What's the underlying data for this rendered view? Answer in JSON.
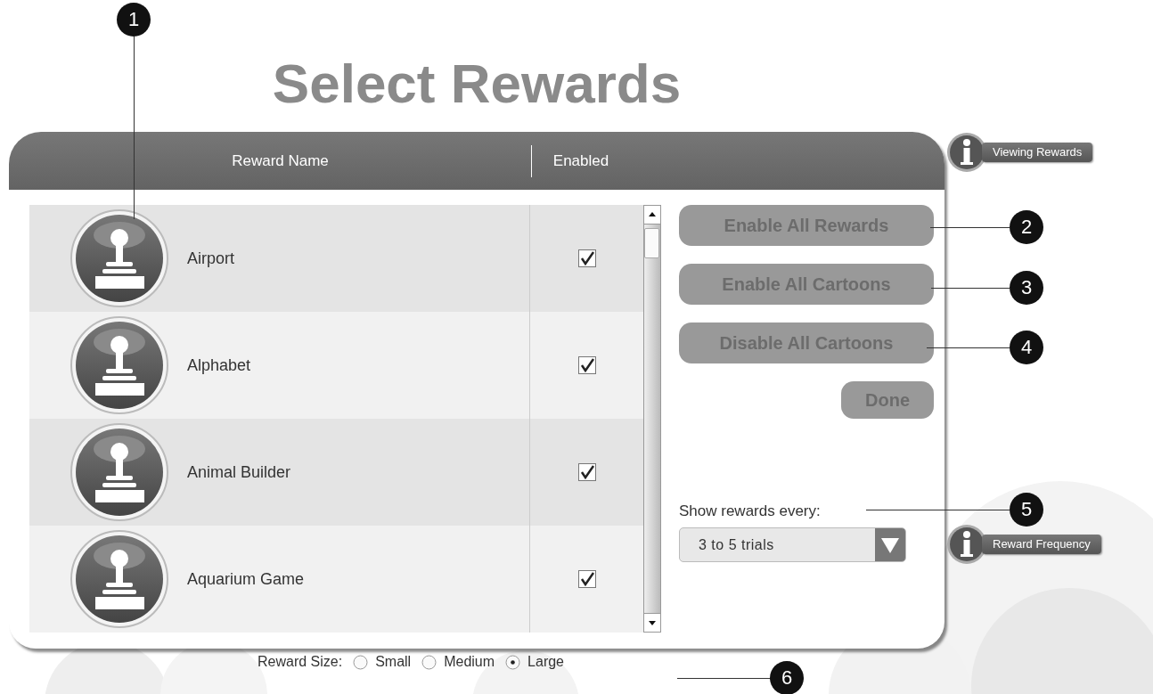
{
  "title": "Select Rewards",
  "table": {
    "columns": [
      "Reward Name",
      "Enabled"
    ],
    "rows": [
      {
        "name": "Airport",
        "enabled": true
      },
      {
        "name": "Alphabet",
        "enabled": true
      },
      {
        "name": "Animal Builder",
        "enabled": true
      },
      {
        "name": "Aquarium Game",
        "enabled": true
      }
    ]
  },
  "actions": [
    "Enable All Rewards",
    "Enable All Cartoons",
    "Disable All Cartoons"
  ],
  "done": "Done",
  "frequency": {
    "label": "Show rewards every:",
    "value": "3 to 5 trials"
  },
  "help_buttons": [
    "Viewing Rewards",
    "Reward Frequency"
  ],
  "reward_size": {
    "label": "Reward Size:",
    "options": [
      {
        "label": "Small",
        "selected": false
      },
      {
        "label": "Medium",
        "selected": false
      },
      {
        "label": "Large",
        "selected": true
      }
    ]
  },
  "callouts": [
    "1",
    "2",
    "3",
    "4",
    "5",
    "6"
  ]
}
